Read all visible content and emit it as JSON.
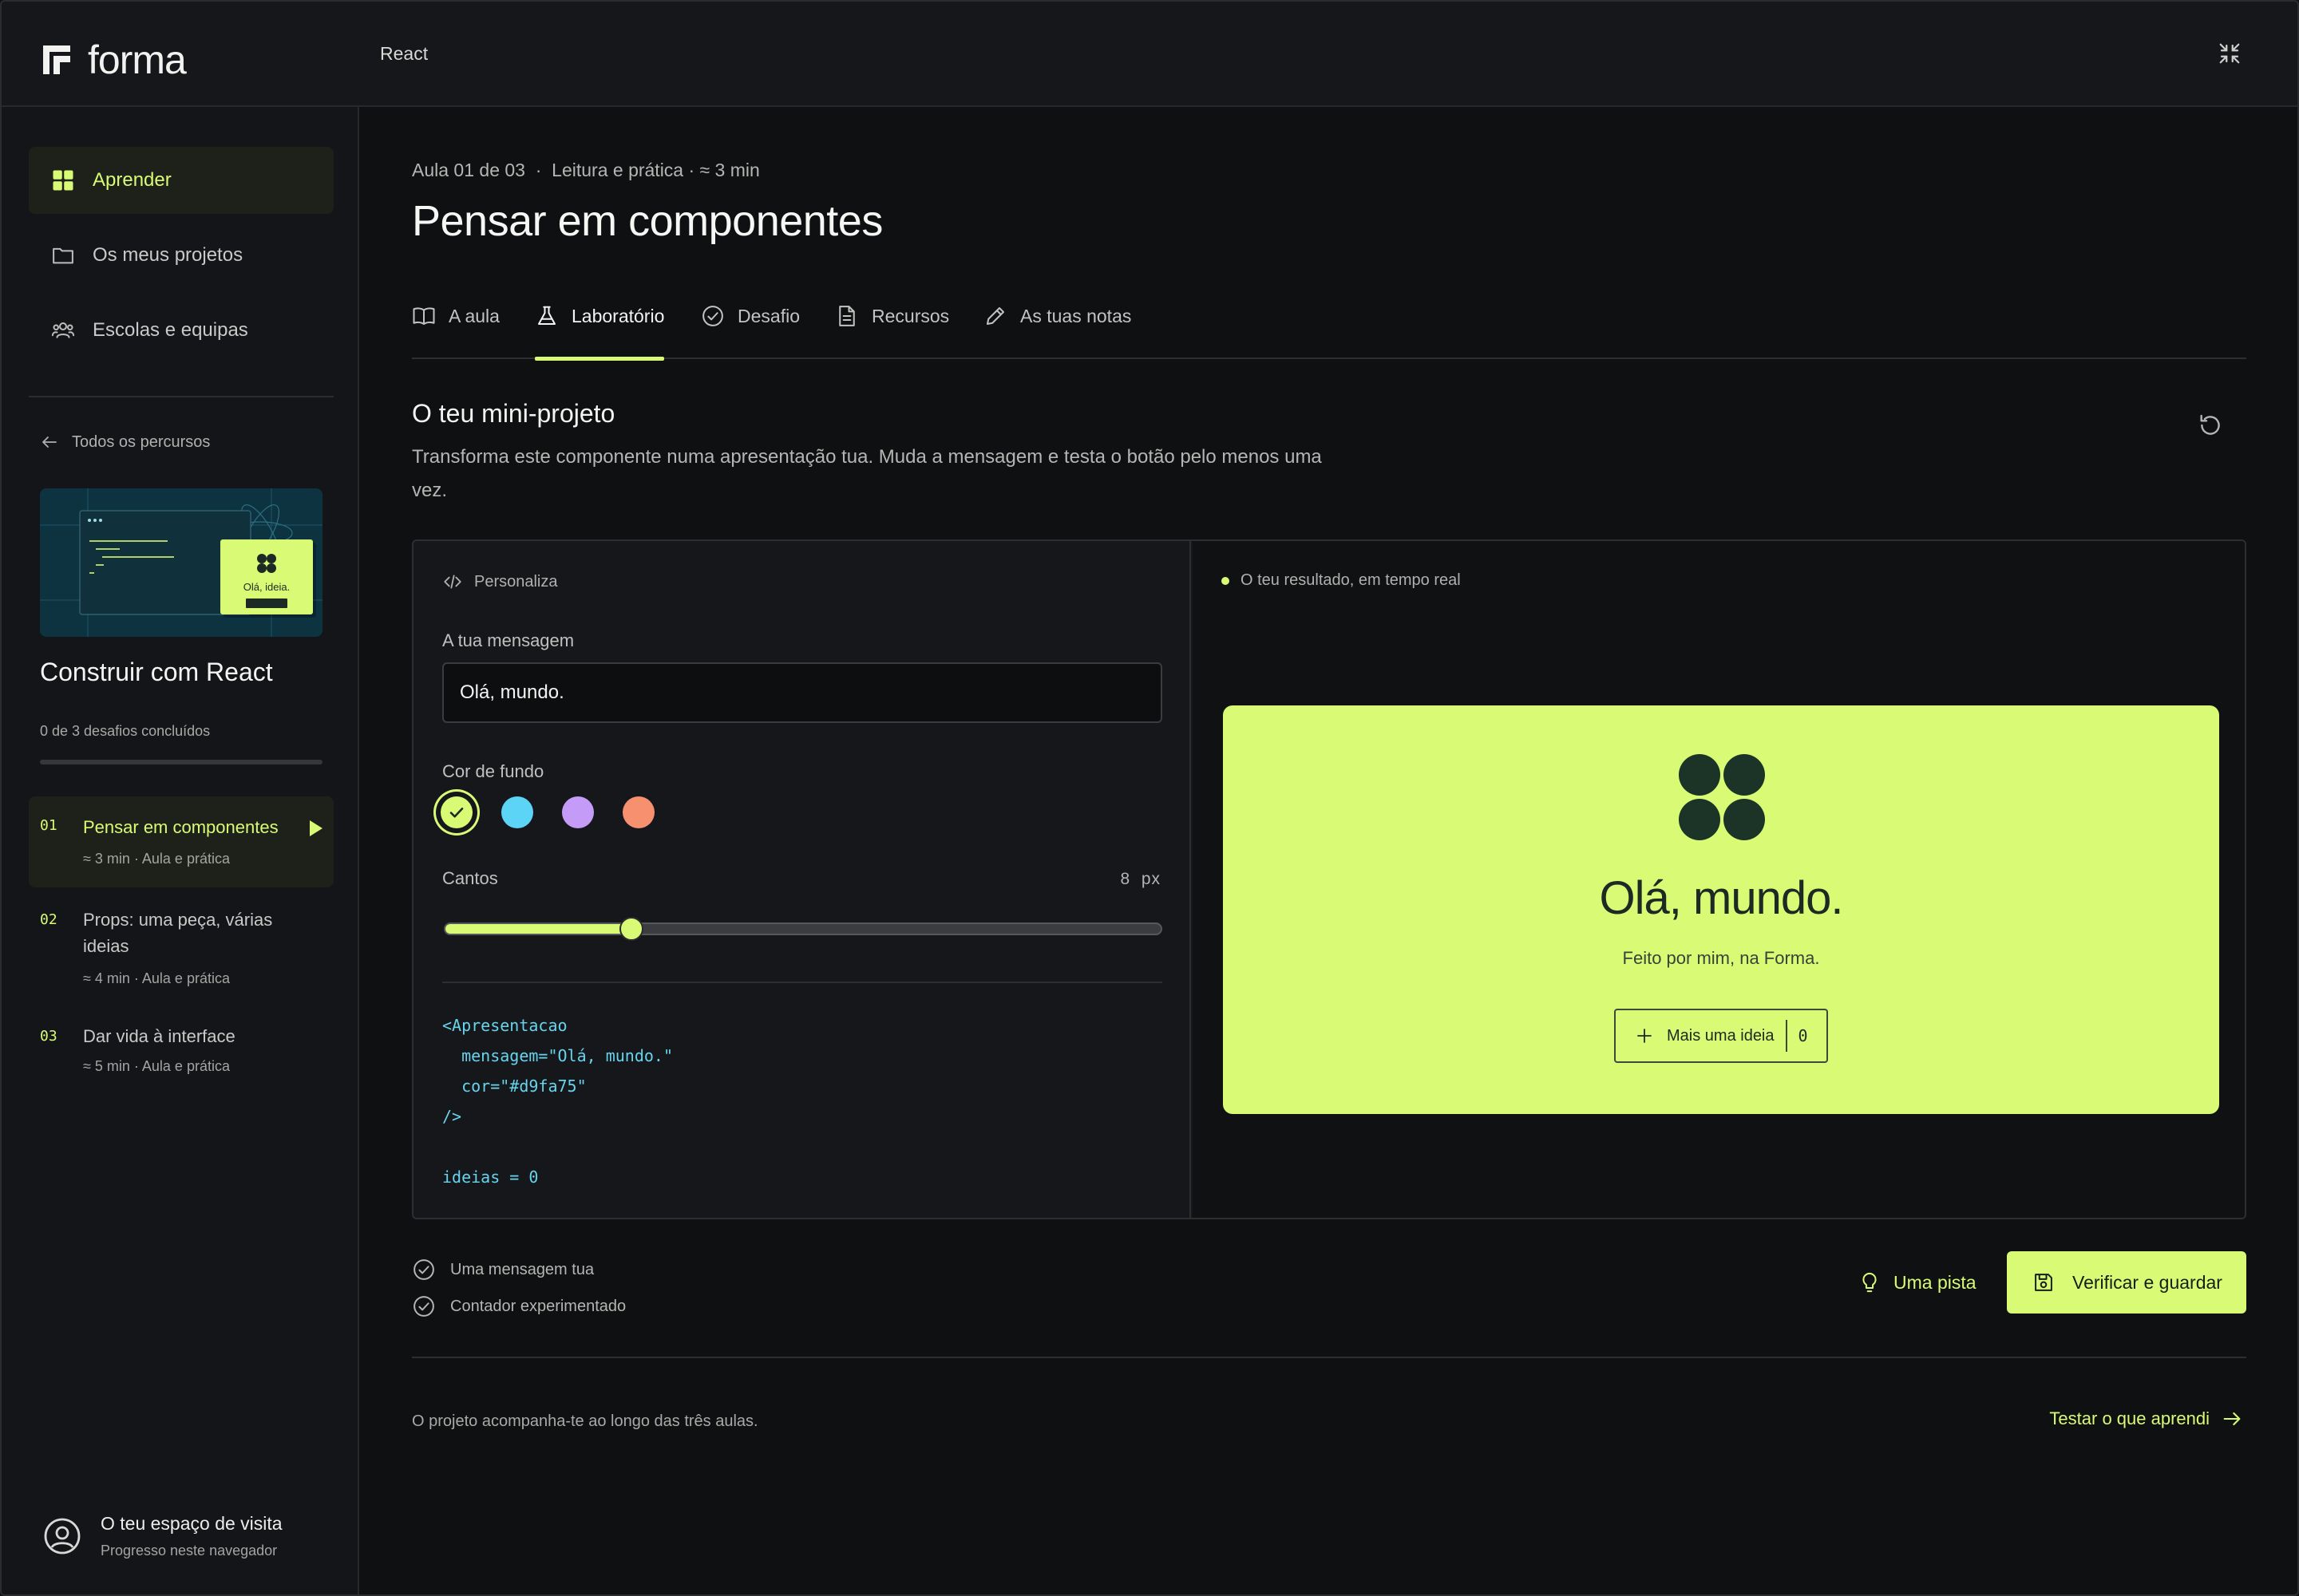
{
  "app": {
    "name": "forma",
    "breadcrumb": "React"
  },
  "colors": {
    "accent": "#d9fa75",
    "swatch_cyan": "#5bd4f5",
    "swatch_purple": "#c49cf7",
    "swatch_coral": "#f7906f"
  },
  "sidebar": {
    "nav": [
      {
        "label": "Aprender",
        "icon": "grid-icon",
        "active": true
      },
      {
        "label": "Os meus projetos",
        "icon": "folder-icon"
      },
      {
        "label": "Escolas e equipas",
        "icon": "users-icon"
      }
    ],
    "back_label": "Todos os percursos",
    "course": {
      "thumb_card_text": "Olá, ideia.",
      "title": "Construir com React",
      "progress_label": "0 de 3 desafios concluídos",
      "progress": 0
    },
    "lessons": [
      {
        "num": "01",
        "title": "Pensar em componentes",
        "meta": "≈ 3 min · Aula e prática",
        "active": true
      },
      {
        "num": "02",
        "title": "Props: uma peça, várias ideias",
        "meta": "≈ 4 min · Aula e prática"
      },
      {
        "num": "03",
        "title": "Dar vida à interface",
        "meta": "≈ 5 min · Aula e prática"
      }
    ],
    "guest": {
      "title": "O teu espaço de visita",
      "subtitle": "Progresso neste navegador"
    }
  },
  "main": {
    "lesson_meta": "Aula 01 de 03  ·  Leitura e prática · ≈ 3 min",
    "title": "Pensar em componentes",
    "tabs": [
      {
        "label": "A aula",
        "icon": "book-icon"
      },
      {
        "label": "Laboratório",
        "icon": "flask-icon",
        "active": true
      },
      {
        "label": "Desafio",
        "icon": "check-circle-icon"
      },
      {
        "label": "Recursos",
        "icon": "document-icon"
      },
      {
        "label": "As tuas notas",
        "icon": "pencil-icon"
      }
    ],
    "section_title": "O teu mini-projeto",
    "section_desc": "Transforma este componente numa apresentação tua. Muda a mensagem e testa o botão pelo menos uma vez.",
    "editor": {
      "label": "Personaliza",
      "message_label": "A tua mensagem",
      "message_value": "Olá, mundo.",
      "bg_label": "Cor de fundo",
      "corners_label": "Cantos",
      "corners_value": "8",
      "corners_unit": "px",
      "corners_fraction": 0.26,
      "code": "<Apresentacao\n  mensagem=\"Olá, mundo.\"\n  cor=\"#d9fa75\"\n/>\n\nideias = 0"
    },
    "preview": {
      "label": "O teu resultado, em tempo real",
      "title": "Olá, mundo.",
      "subtitle": "Feito por mim, na Forma.",
      "button_label": "Mais uma ideia",
      "count": "0"
    },
    "checks": [
      "Uma mensagem tua",
      "Contador experimentado"
    ],
    "hint_label": "Uma pista",
    "verify_label": "Verificar e guardar",
    "footer_note": "O projeto acompanha-te ao longo das três aulas.",
    "next_label": "Testar o que aprendi"
  }
}
